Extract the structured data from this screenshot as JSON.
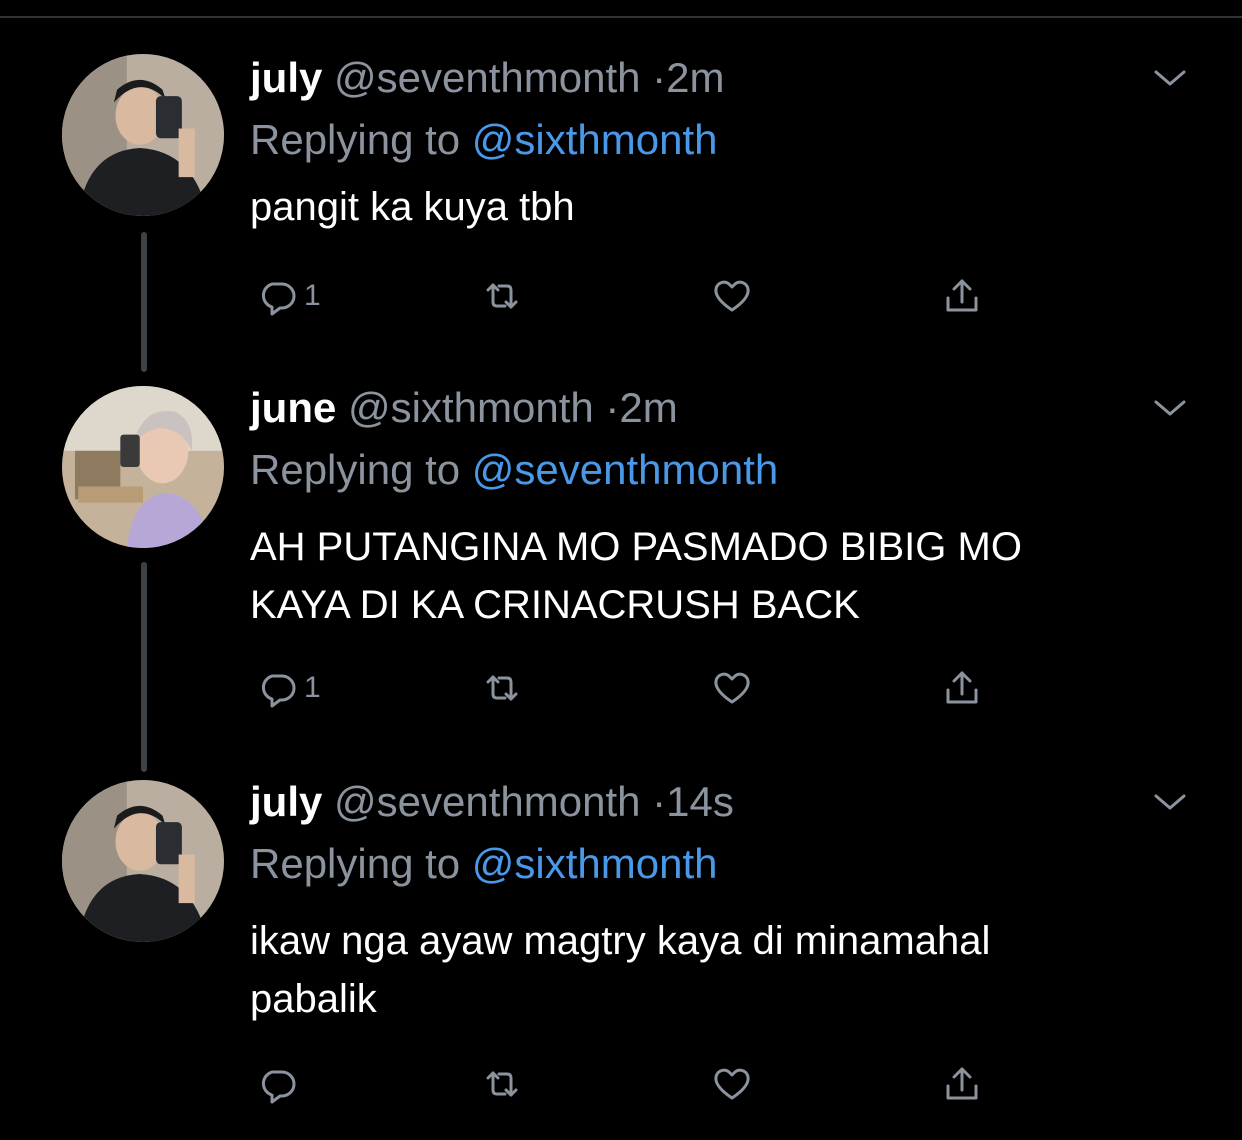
{
  "tweets": [
    {
      "name": "july",
      "handle": "@seventhmonth",
      "separator": "·",
      "time": "2m",
      "replying_prefix": "Replying to",
      "replying_handle": "@sixthmonth",
      "text_lines": [
        "pangit ka kuya tbh"
      ],
      "reply_count": "1"
    },
    {
      "name": "june",
      "handle": "@sixthmonth",
      "separator": "·",
      "time": "2m",
      "replying_prefix": "Replying to",
      "replying_handle": "@seventhmonth",
      "text_lines": [
        "AH PUTANGINA MO PASMADO BIBIG MO",
        "KAYA DI KA CRINACRUSH BACK"
      ],
      "reply_count": "1"
    },
    {
      "name": "july",
      "handle": "@seventhmonth",
      "separator": "·",
      "time": "14s",
      "replying_prefix": "Replying to",
      "replying_handle": "@sixthmonth",
      "text_lines": [
        "ikaw nga ayaw magtry kaya di minamahal",
        "pabalik"
      ],
      "reply_count": ""
    }
  ],
  "icons": {
    "reply": "reply-icon",
    "retweet": "retweet-icon",
    "like": "heart-icon",
    "share": "share-icon",
    "more": "chevron-down-icon"
  },
  "colors": {
    "background": "#000000",
    "name": "#ffffff",
    "secondary": "#8b949e",
    "link": "#4a99e9"
  }
}
